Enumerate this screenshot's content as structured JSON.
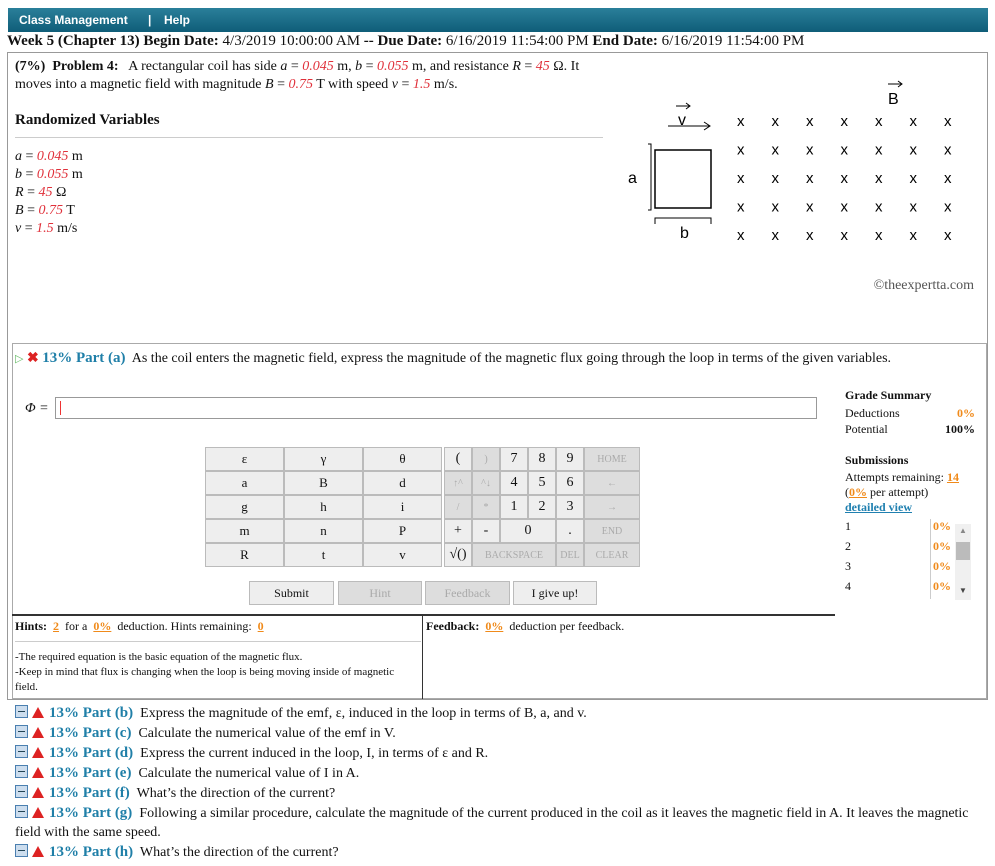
{
  "topbar": {
    "class_management": "Class Management",
    "sep": "|",
    "help": "Help"
  },
  "week": {
    "label": "Week 5 (Chapter 13) Begin Date:",
    "begin": "4/3/2019 10:00:00 AM",
    "sep": "--",
    "due_label": "Due Date:",
    "due": "6/16/2019 11:54:00 PM",
    "end_label": "End Date:",
    "end": "6/16/2019 11:54:00 PM"
  },
  "problem": {
    "weight": "(7%)",
    "number": "Problem 4:",
    "t1": "A rectangular coil has side",
    "a_val": "0.045",
    "t2": "m,",
    "b_val": "0.055",
    "t3": "m, and resistance",
    "r_val": "45",
    "t4": "Ω. It moves into a magnetic field with magnitude",
    "B_val": "0.75",
    "t5": "T with speed",
    "v_val": "1.5",
    "t6": "m/s."
  },
  "randomized": {
    "title": "Randomized Variables",
    "vars": [
      {
        "name": "a",
        "val": "0.045",
        "unit": "m"
      },
      {
        "name": "b",
        "val": "0.055",
        "unit": "m"
      },
      {
        "name": "R",
        "val": "45",
        "unit": "Ω"
      },
      {
        "name": "B",
        "val": "0.75",
        "unit": "T"
      },
      {
        "name": "v",
        "val": "1.5",
        "unit": "m/s"
      }
    ]
  },
  "diagram": {
    "B_label": "B",
    "v_label": "v",
    "a_label": "a",
    "b_label": "b",
    "x": "x"
  },
  "copyright": "©theexpertta.com",
  "part_a": {
    "pct": "13% Part (a)",
    "text": "As the coil enters the magnetic field, express the magnitude of the magnetic flux going through the loop in terms of the given variables.",
    "phi": "Φ ="
  },
  "keypad": {
    "vars": [
      "ε",
      "γ",
      "θ",
      "a",
      "B",
      "d",
      "g",
      "h",
      "i",
      "m",
      "n",
      "P",
      "R",
      "t",
      "v"
    ],
    "ops": [
      "(",
      ")",
      "7",
      "8",
      "9",
      "HOME",
      "↑^",
      "^↓",
      "4",
      "5",
      "6",
      "←",
      "/",
      "*",
      "1",
      "2",
      "3",
      "→",
      "+",
      "-",
      "0",
      ".",
      "END",
      "√()",
      "BACKSPACE",
      "DEL",
      "CLEAR"
    ]
  },
  "buttons": {
    "submit": "Submit",
    "hint": "Hint",
    "feedback": "Feedback",
    "give_up": "I give up!"
  },
  "grade": {
    "title": "Grade Summary",
    "deductions_label": "Deductions",
    "deductions": "0%",
    "potential_label": "Potential",
    "potential": "100%",
    "submissions": "Submissions",
    "attempts_label": "Attempts remaining:",
    "attempts": "14",
    "per_attempt_pct": "0%",
    "per_attempt": "per attempt)",
    "detailed": "detailed view",
    "rows": [
      {
        "n": "1",
        "v": "0%"
      },
      {
        "n": "2",
        "v": "0%"
      },
      {
        "n": "3",
        "v": "0%"
      },
      {
        "n": "4",
        "v": "0%"
      }
    ]
  },
  "hints": {
    "label": "Hints:",
    "count": "2",
    "for_a": "for a",
    "pct": "0%",
    "deduction": "deduction. Hints remaining:",
    "remaining": "0",
    "h1": "-The required equation is the basic equation of the magnetic flux.",
    "h2": "-Keep in mind that flux is changing when the loop is being moving inside of magnetic field."
  },
  "feedback": {
    "label": "Feedback:",
    "pct": "0%",
    "text": "deduction per feedback."
  },
  "parts": [
    {
      "pct": "13% Part (b)",
      "text": "Express the magnitude of the emf, ε, induced in the loop in terms of B, a, and v."
    },
    {
      "pct": "13% Part (c)",
      "text": "Calculate the numerical value of the emf in V."
    },
    {
      "pct": "13% Part (d)",
      "text": "Express the current induced in the loop, I, in terms of ε and R."
    },
    {
      "pct": "13% Part (e)",
      "text": "Calculate the numerical value of I in A."
    },
    {
      "pct": "13% Part (f)",
      "text": "What’s the direction of the current?"
    },
    {
      "pct": "13% Part (g)",
      "text": "Following a similar procedure, calculate the magnitude of the current produced in the coil as it leaves the magnetic field in A. It leaves the magnetic field with the same speed."
    },
    {
      "pct": "13% Part (h)",
      "text": "What’s the direction of the current?"
    }
  ]
}
